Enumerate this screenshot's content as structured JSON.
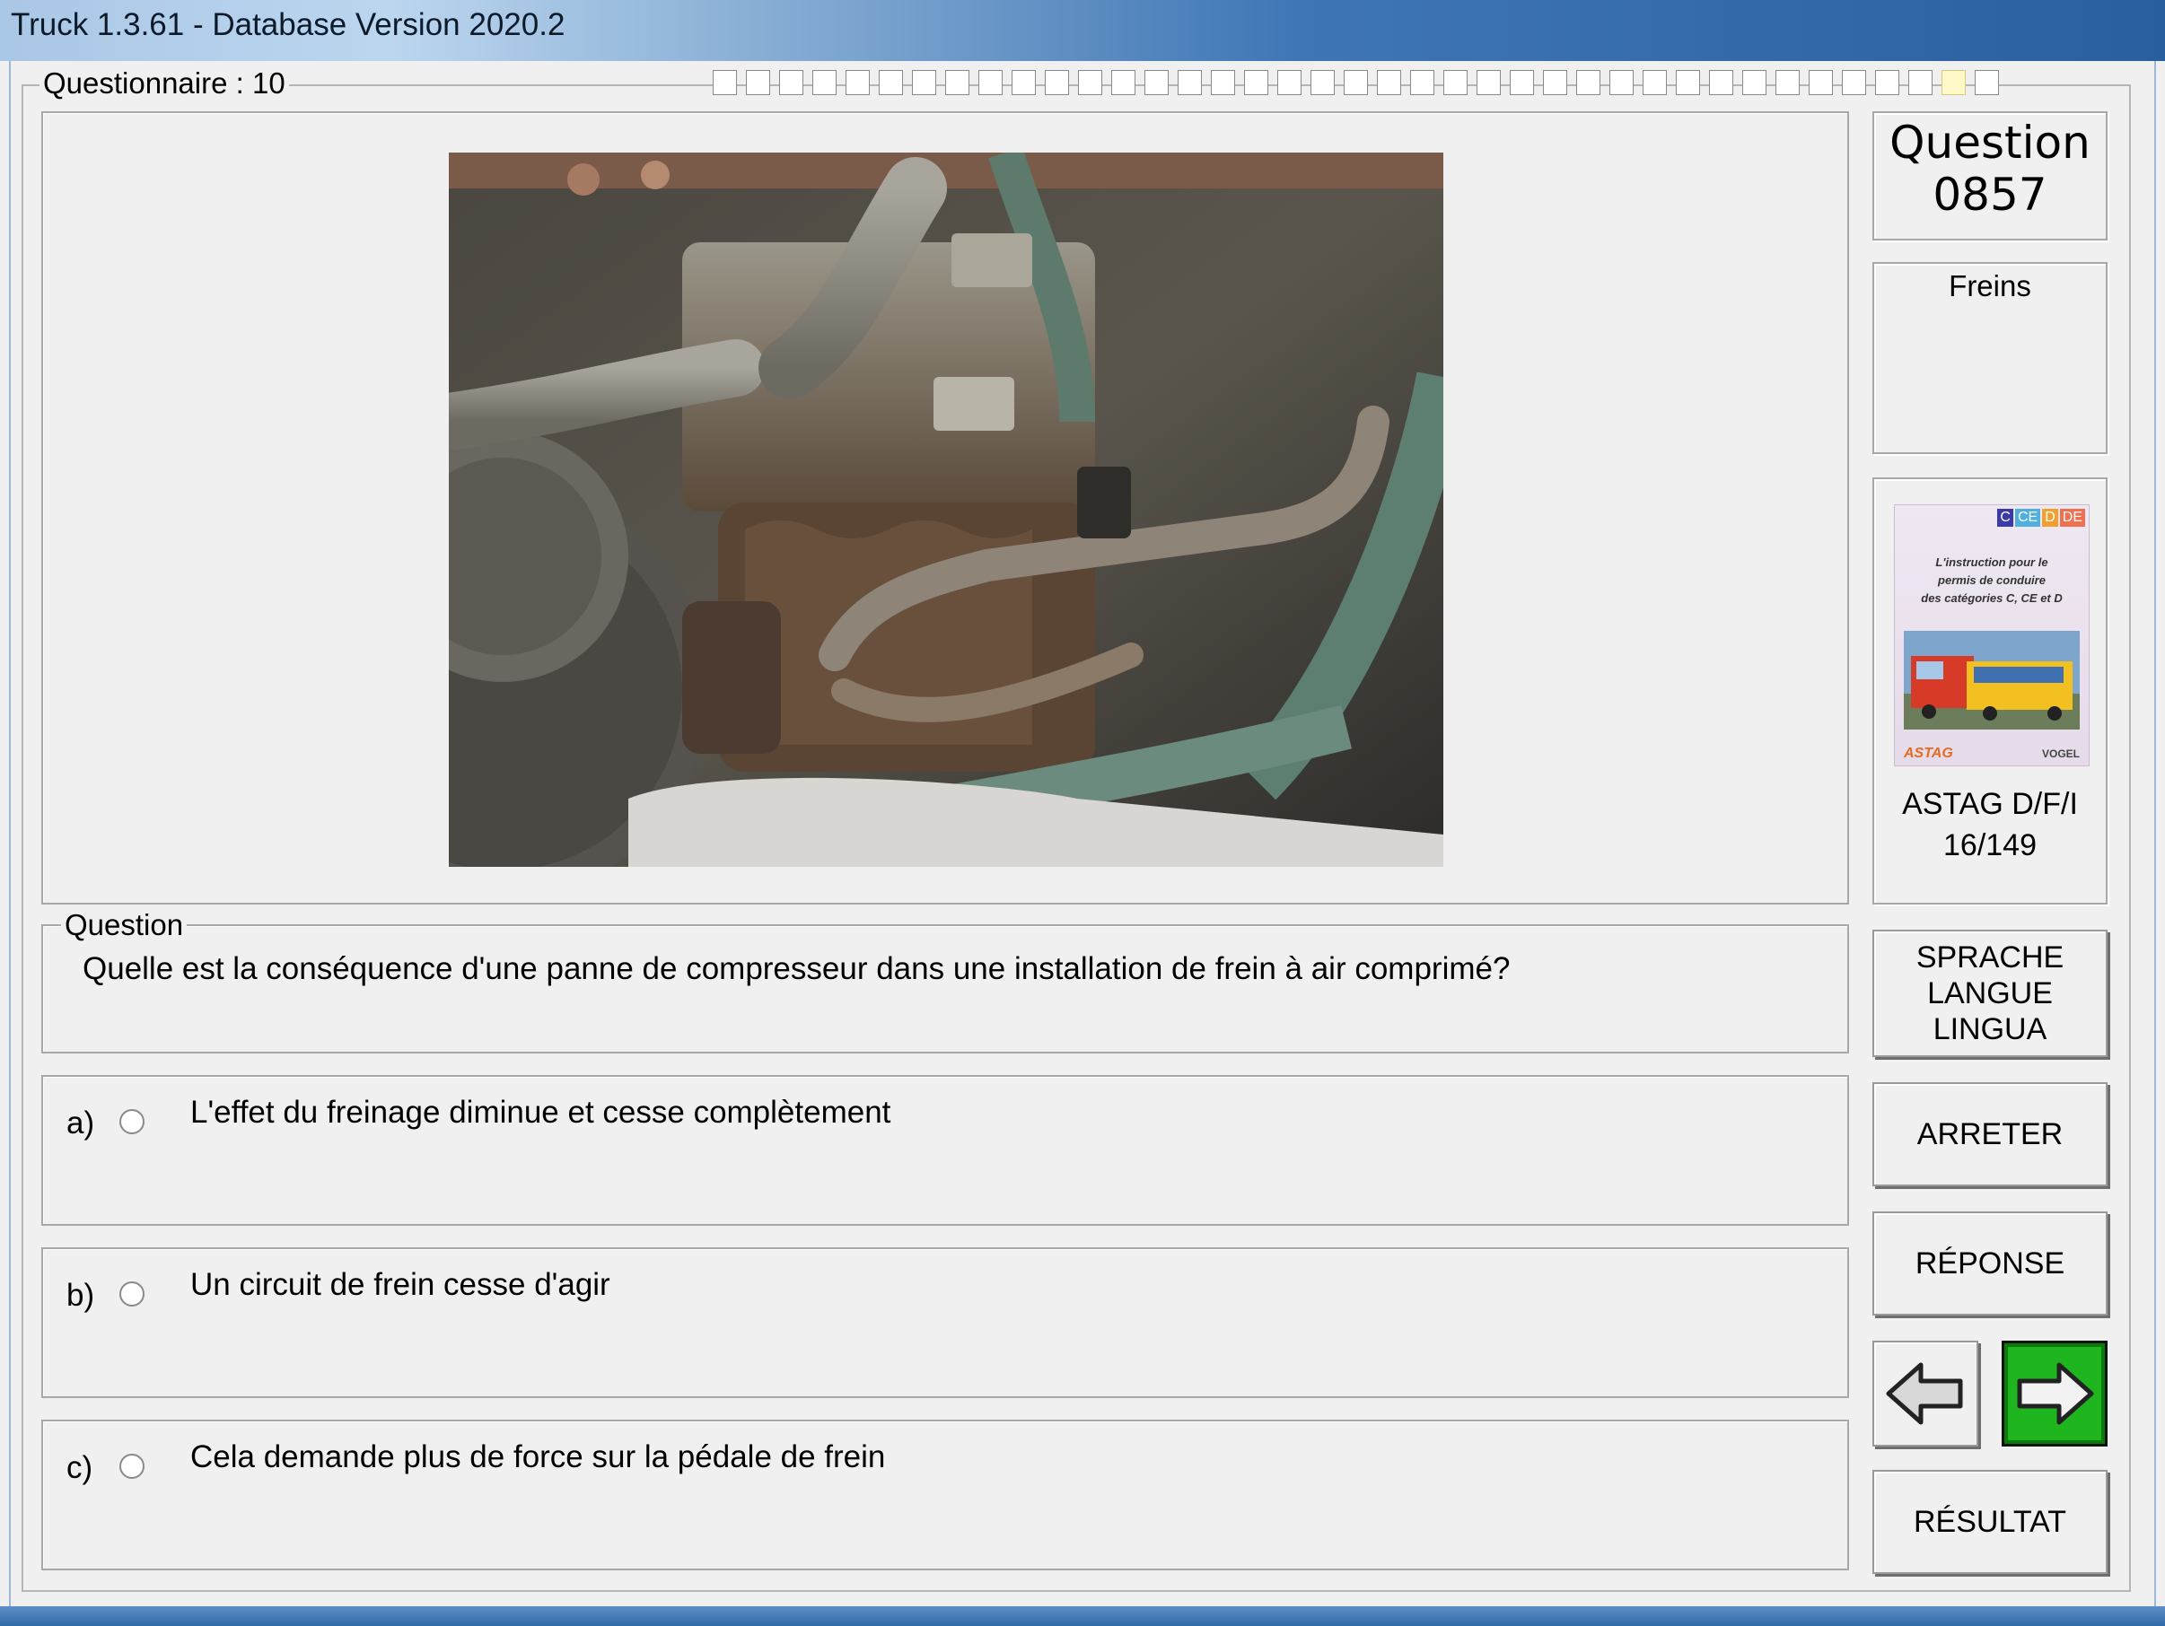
{
  "window": {
    "title": "Truck 1.3.61 - Database Version 2020.2"
  },
  "questionnaire": {
    "label": "Questionnaire : 10",
    "progress_total": 39,
    "progress_current_index": 37
  },
  "question_info": {
    "label": "Question",
    "number": "0857",
    "category": "Freins"
  },
  "book": {
    "badges": [
      "C",
      "CE",
      "D",
      "DE"
    ],
    "cover_lines": [
      "L'instruction pour le",
      "permis de conduire",
      "des catégories C, CE et D"
    ],
    "publisher_left": "ASTAG",
    "publisher_right": "VOGEL",
    "name": "ASTAG D/F/I",
    "ref": "16/149"
  },
  "question": {
    "group_label": "Question",
    "text": "Quelle est la conséquence d'une panne de compresseur dans une installation de frein à air comprimé?"
  },
  "answers": [
    {
      "letter": "a)",
      "text": "L'effet du freinage diminue et cesse complètement"
    },
    {
      "letter": "b)",
      "text": "Un circuit de frein cesse d'agir"
    },
    {
      "letter": "c)",
      "text": "Cela demande plus de force sur la pédale de frein"
    }
  ],
  "buttons": {
    "language": [
      "SPRACHE",
      "LANGUE",
      "LINGUA"
    ],
    "stop": "ARRETER",
    "answer": "RÉPONSE",
    "result": "RÉSULTAT"
  },
  "colors": {
    "next_button": "#1fb51f",
    "title_bar": "#3f76b5"
  }
}
